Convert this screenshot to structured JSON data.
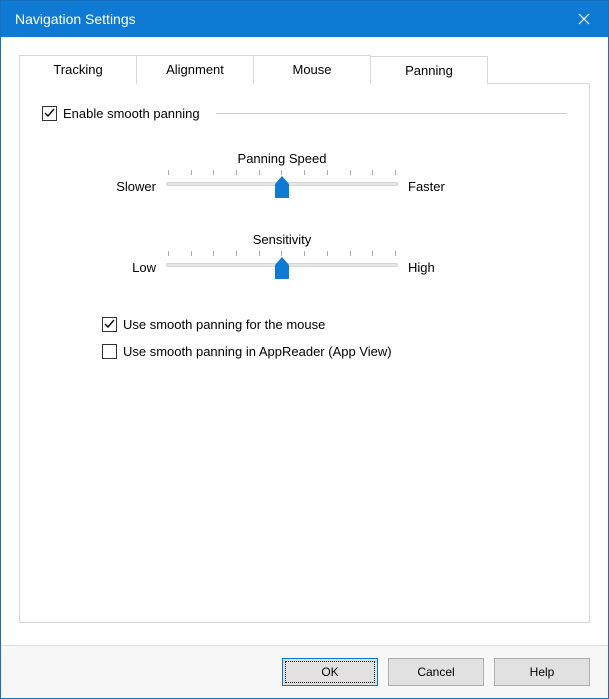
{
  "window": {
    "title": "Navigation Settings"
  },
  "tabs": [
    {
      "label": "Tracking"
    },
    {
      "label": "Alignment"
    },
    {
      "label": "Mouse"
    },
    {
      "label": "Panning"
    }
  ],
  "panel": {
    "enable_label": "Enable smooth panning",
    "enable_checked": true,
    "sliders": {
      "speed": {
        "title": "Panning Speed",
        "left": "Slower",
        "right": "Faster",
        "position_pct": 50
      },
      "sensitivity": {
        "title": "Sensitivity",
        "left": "Low",
        "right": "High",
        "position_pct": 50
      }
    },
    "sub": {
      "mouse_label": "Use smooth panning for the mouse",
      "mouse_checked": true,
      "appreader_label": "Use smooth panning in AppReader (App View)",
      "appreader_checked": false
    }
  },
  "buttons": {
    "ok": "OK",
    "cancel": "Cancel",
    "help": "Help"
  }
}
